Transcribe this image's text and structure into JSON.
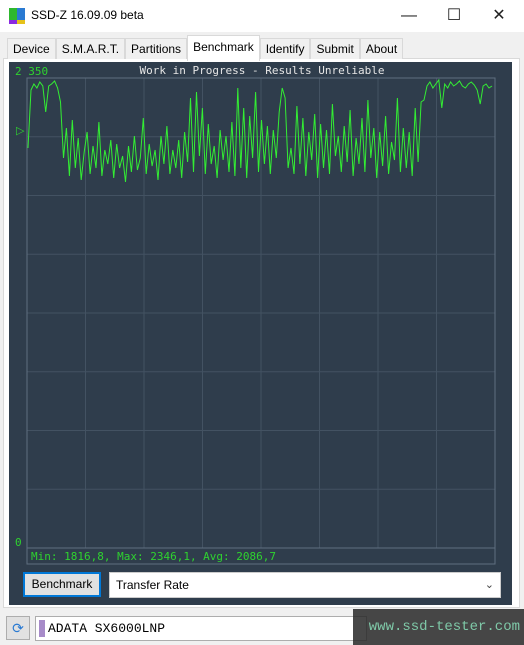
{
  "window": {
    "title": "SSD-Z 16.09.09 beta",
    "minimize": "—",
    "maximize": "☐",
    "close": "✕"
  },
  "tabs": [
    {
      "label": "Device"
    },
    {
      "label": "S.M.A.R.T."
    },
    {
      "label": "Partitions"
    },
    {
      "label": "Benchmark",
      "active": true
    },
    {
      "label": "Identify"
    },
    {
      "label": "Submit"
    },
    {
      "label": "About"
    }
  ],
  "chart_data": {
    "type": "line",
    "title": "Work in Progress - Results Unreliable",
    "ymax_label": "2 350",
    "ymin_label": "0",
    "ylim": [
      0,
      2350
    ],
    "grid": true,
    "line_color": "#33ee33",
    "marker": "▷",
    "stats": "Min: 1816,8, Max: 2346,1, Avg: 2086,7",
    "values": [
      2000,
      2290,
      2320,
      2300,
      2330,
      2310,
      2180,
      2310,
      2320,
      2335,
      2300,
      2230,
      1950,
      2100,
      1860,
      2140,
      1900,
      2050,
      1840,
      1980,
      2080,
      1870,
      2010,
      1900,
      2130,
      1860,
      1990,
      1920,
      2040,
      1850,
      2020,
      1900,
      1960,
      1830,
      2010,
      1880,
      2060,
      1890,
      1950,
      2150,
      1870,
      2020,
      1910,
      1990,
      1840,
      2060,
      1920,
      2110,
      1870,
      1990,
      1900,
      2040,
      1850,
      2080,
      1930,
      2250,
      1880,
      2280,
      1960,
      2200,
      1870,
      2120,
      1920,
      2010,
      1850,
      2090,
      1940,
      2060,
      1880,
      2130,
      1860,
      2300,
      1900,
      2200,
      1850,
      2160,
      1950,
      2280,
      1880,
      2140,
      1920,
      2110,
      1870,
      2090,
      1950,
      2180,
      2300,
      2250,
      1900,
      2000,
      1870,
      2210,
      1920,
      2150,
      1860,
      2080,
      1940,
      2170,
      1850,
      2120,
      1900,
      2090,
      1870,
      2220,
      1960,
      2060,
      1880,
      2110,
      1930,
      2190,
      1860,
      2050,
      1920,
      2150,
      1880,
      2240,
      1950,
      2100,
      1850,
      2080,
      1910,
      2160,
      1870,
      2030,
      1940,
      2250,
      1880,
      2100,
      1900,
      2080,
      1860,
      2200,
      1930,
      2230,
      2240,
      2310,
      2330,
      2300,
      2320,
      2340,
      2200,
      2320,
      2300,
      2330,
      2310,
      2320,
      2335,
      2310,
      2300,
      2320,
      2330,
      2315,
      2290,
      2220,
      2310,
      2320,
      2300,
      2310
    ]
  },
  "controls": {
    "benchmark_button": "Benchmark",
    "mode_select": "Transfer Rate",
    "chevron": "⌄"
  },
  "footer": {
    "drive": "ADATA SX6000LNP",
    "drive_color": "#a78bc9",
    "watermark": "www.ssd-tester.com",
    "refresh_icon": "⟳"
  }
}
